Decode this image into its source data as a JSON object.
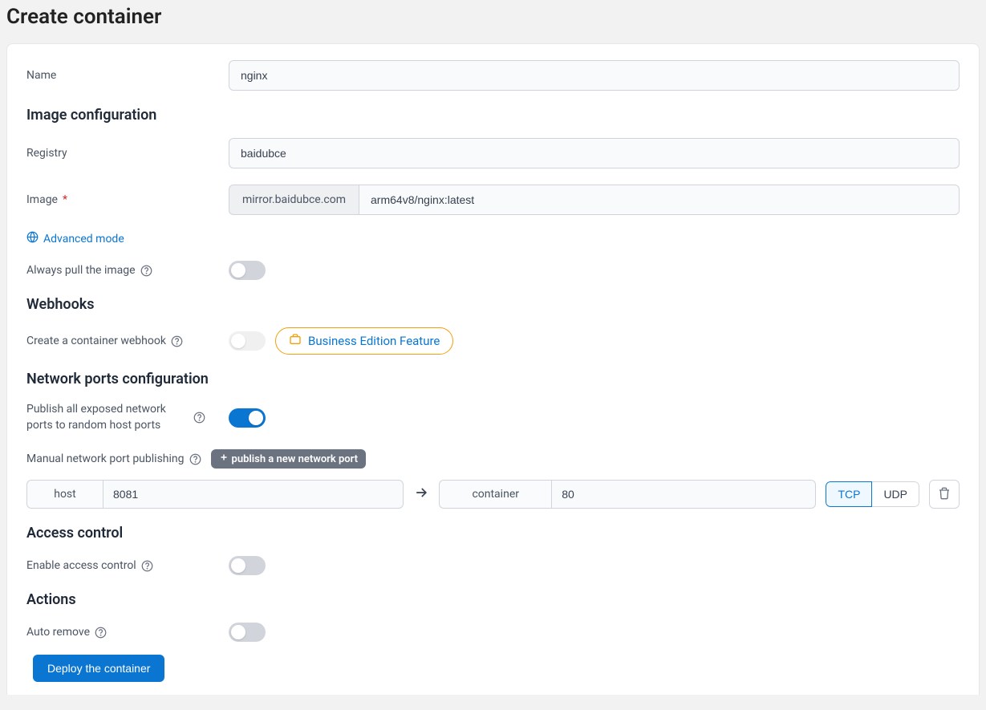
{
  "page": {
    "title": "Create container"
  },
  "form": {
    "name_label": "Name",
    "name_value": "nginx",
    "image_section_title": "Image configuration",
    "registry_label": "Registry",
    "registry_value": "baidubce",
    "image_label": "Image",
    "image_addon": "mirror.baidubce.com",
    "image_value": "arm64v8/nginx:latest",
    "advanced_mode": "Advanced mode",
    "always_pull_label": "Always pull the image",
    "webhooks_title": "Webhooks",
    "create_webhook_label": "Create a container webhook",
    "business_feature": "Business Edition Feature",
    "network_title": "Network ports configuration",
    "publish_all_label": "Publish all exposed network ports to random host ports",
    "manual_publish_label": "Manual network port publishing",
    "publish_new_port": "publish a new network port",
    "host_label": "host",
    "host_value": "8081",
    "container_label": "container",
    "container_value": "80",
    "tcp_label": "TCP",
    "udp_label": "UDP",
    "access_title": "Access control",
    "enable_access_label": "Enable access control",
    "actions_title": "Actions",
    "auto_remove_label": "Auto remove",
    "deploy_label": "Deploy the container"
  },
  "toggles": {
    "always_pull": false,
    "webhook": false,
    "publish_all": true,
    "access_control": false,
    "auto_remove": false
  }
}
